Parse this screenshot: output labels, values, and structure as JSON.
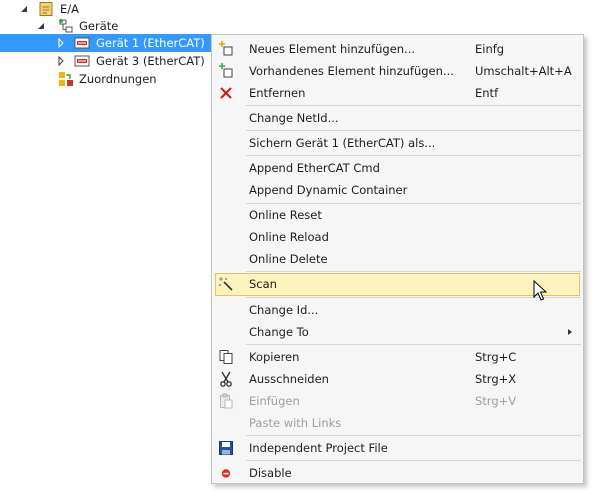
{
  "tree": {
    "root": {
      "label": "E/A",
      "icon": "io-folder-icon"
    },
    "geraete": {
      "label": "Geräte",
      "icon": "devices-icon"
    },
    "device1": {
      "label": "Gerät 1 (EtherCAT)",
      "icon": "ethercat-device-icon"
    },
    "device3": {
      "label": "Gerät 3 (EtherCAT)",
      "icon": "ethercat-device-icon"
    },
    "mappings": {
      "label": "Zuordnungen",
      "icon": "mappings-icon"
    }
  },
  "menu": {
    "add_new": {
      "label": "Neues Element hinzufügen...",
      "shortcut": "Einfg"
    },
    "add_existing": {
      "label": "Vorhandenes Element hinzufügen...",
      "shortcut": "Umschalt+Alt+A"
    },
    "remove": {
      "label": "Entfernen",
      "shortcut": "Entf"
    },
    "change_netid": {
      "label": "Change NetId..."
    },
    "save_as": {
      "label": "Sichern Gerät 1 (EtherCAT) als..."
    },
    "append_cmd": {
      "label": "Append EtherCAT Cmd"
    },
    "append_container": {
      "label": "Append Dynamic Container"
    },
    "online_reset": {
      "label": "Online Reset"
    },
    "online_reload": {
      "label": "Online Reload"
    },
    "online_delete": {
      "label": "Online Delete"
    },
    "scan": {
      "label": "Scan"
    },
    "change_id": {
      "label": "Change Id..."
    },
    "change_to": {
      "label": "Change To"
    },
    "copy": {
      "label": "Kopieren",
      "shortcut": "Strg+C"
    },
    "cut": {
      "label": "Ausschneiden",
      "shortcut": "Strg+X"
    },
    "paste": {
      "label": "Einfügen",
      "shortcut": "Strg+V"
    },
    "paste_links": {
      "label": "Paste with Links"
    },
    "independent_file": {
      "label": "Independent Project File"
    },
    "disable": {
      "label": "Disable"
    }
  },
  "colors": {
    "selection": "#3399ff",
    "menu_background": "#f6f6f6",
    "hover_background": "#fdf3bd",
    "hover_border": "#e5c365",
    "disabled_text": "#a0a0a0"
  }
}
